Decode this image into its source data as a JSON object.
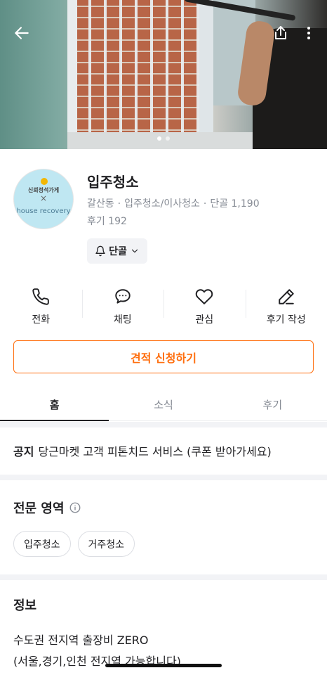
{
  "hero": {
    "image_alt": "window cleaning photo",
    "carousel": {
      "count": 2,
      "active": 0
    }
  },
  "profile": {
    "avatar_lines": [
      "신뢰정석가게",
      "×",
      "house recovery"
    ],
    "name": "입주청소",
    "location": "갈산동",
    "category": "입주청소/이사청소",
    "regulars": "단골 1,190",
    "reviews": "후기 192",
    "follow_label": "단골"
  },
  "actions": [
    {
      "label": "전화",
      "icon": "phone-icon"
    },
    {
      "label": "채팅",
      "icon": "chat-icon"
    },
    {
      "label": "관심",
      "icon": "heart-icon"
    },
    {
      "label": "후기 작성",
      "icon": "pencil-icon"
    }
  ],
  "cta": {
    "label": "견적 신청하기"
  },
  "tabs": [
    {
      "label": "홈",
      "active": true
    },
    {
      "label": "소식",
      "active": false
    },
    {
      "label": "후기",
      "active": false
    }
  ],
  "notice": {
    "prefix": "공지",
    "text": "당근마켓 고객 피톤치드 서비스 (쿠폰 받아가세요)"
  },
  "specialty": {
    "title": "전문 영역",
    "chips": [
      "입주청소",
      "거주청소"
    ]
  },
  "info": {
    "title": "정보",
    "lines": [
      "수도권 전지역 출장비 ZERO",
      "(서울,경기,인천 전지역 가능합니다)"
    ]
  },
  "colors": {
    "accent": "#ff6f0f",
    "text": "#212124",
    "muted": "#868b94",
    "divider": "#f2f3f6"
  }
}
